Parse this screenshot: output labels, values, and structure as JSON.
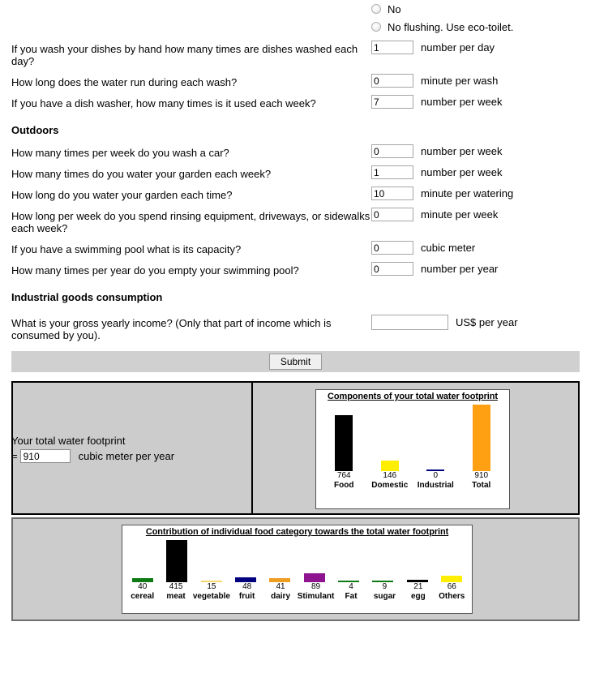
{
  "radios": [
    {
      "label": "No",
      "selected": false
    },
    {
      "label": "No flushing. Use eco-toilet.",
      "selected": false
    }
  ],
  "questions_indoor": [
    {
      "label": "If you wash your dishes by hand how many times are dishes washed each day?",
      "value": "1",
      "unit": "number per day"
    },
    {
      "label": "How long does the water run during each wash?",
      "value": "0",
      "unit": "minute per wash"
    },
    {
      "label": "If you have a dish washer, how many times is it used each week?",
      "value": "7",
      "unit": "number per week"
    }
  ],
  "outdoors": {
    "heading": "Outdoors",
    "questions": [
      {
        "label": "How many times per week do you wash a car?",
        "value": "0",
        "unit": "number per week"
      },
      {
        "label": "How many times do you water your garden each week?",
        "value": "1",
        "unit": "number per week"
      },
      {
        "label": "How long do you water your garden each time?",
        "value": "10",
        "unit": "minute per watering"
      },
      {
        "label": "How long per week do you spend rinsing equipment, driveways, or sidewalks each week?",
        "value": "0",
        "unit": "minute per week"
      },
      {
        "label": "If you have a swimming pool what is its capacity?",
        "value": "0",
        "unit": "cubic meter"
      },
      {
        "label": "How many times per year do you empty your swimming pool?",
        "value": "0",
        "unit": "number per year"
      }
    ]
  },
  "industrial": {
    "heading": "Industrial goods consumption",
    "questions": [
      {
        "label": "What is your gross yearly income? (Only that part of income which is consumed by you).",
        "value": "",
        "unit": "US$ per year"
      }
    ]
  },
  "submit": {
    "label": "Submit"
  },
  "total": {
    "label": "Your total water footprint",
    "equals": "=",
    "value": "910",
    "unit": "cubic meter per year"
  },
  "chart_data": [
    {
      "type": "bar",
      "title": "Components of your total water footprint",
      "categories": [
        "Food",
        "Domestic",
        "Industrial",
        "Total"
      ],
      "values": [
        764,
        146,
        0,
        910
      ],
      "colors": [
        "#000000",
        "#ffee00",
        "#00007f",
        "#ffa013"
      ],
      "xlabel": "",
      "ylabel": "",
      "ylim": [
        0,
        910
      ],
      "grid": false,
      "legend": "none"
    },
    {
      "type": "bar",
      "title": "Contribution of individual food category towards the total water footprint",
      "categories": [
        "cereal",
        "meat",
        "vegetable",
        "fruit",
        "dairy",
        "Stimulant",
        "Fat",
        "sugar",
        "egg",
        "Others"
      ],
      "values": [
        40,
        415,
        15,
        48,
        41,
        89,
        4,
        9,
        21,
        66
      ],
      "colors": [
        "#0e7a14",
        "#000000",
        "#f5d76e",
        "#00007f",
        "#ee9f22",
        "#8e138e",
        "#0e7a14",
        "#0e7a14",
        "#000000",
        "#ffee00"
      ],
      "xlabel": "",
      "ylabel": "",
      "ylim": [
        0,
        415
      ],
      "grid": false,
      "legend": "none"
    }
  ]
}
